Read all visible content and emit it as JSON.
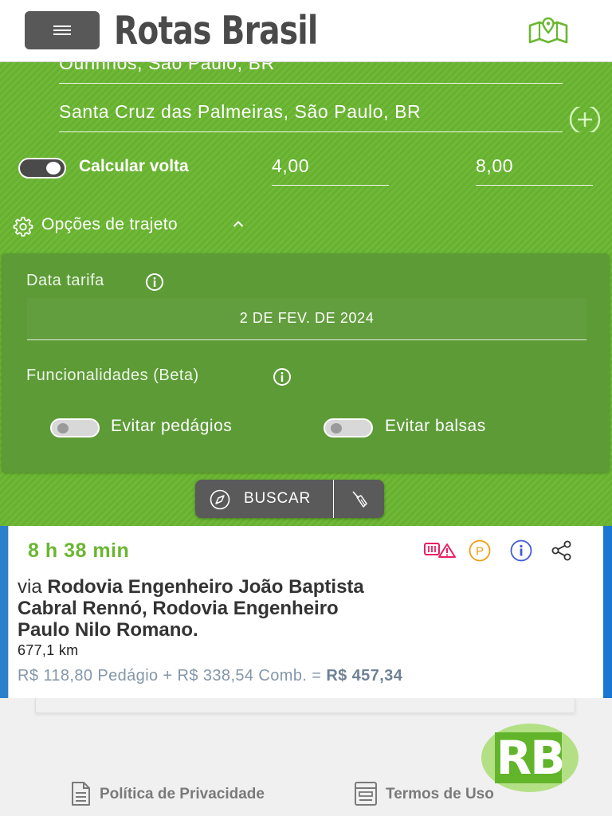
{
  "header": {
    "logo_text": "Rotas Brasil",
    "menu_icon": "hamburger-icon",
    "map_icon": "map-pin-icon"
  },
  "route": {
    "origin": "Ourinhos, São Paulo, BR",
    "destination": "Santa Cruz das Palmeiras, São Paulo, BR",
    "add_icon": "plus-circle-icon"
  },
  "options": {
    "calcular_volta_label": "Calcular volta",
    "calcular_volta_on": true,
    "fuel_consumption": "4,00",
    "fuel_price": "8,00",
    "trajeto_label": "Opções de trajeto"
  },
  "panel": {
    "data_tarifa_label": "Data tarifa",
    "date_value": "2 DE FEV. DE 2024",
    "funcionalidades_label": "Funcionalidades (Beta)",
    "evitar_pedagios": "Evitar pedágios",
    "evitar_pedagios_on": false,
    "evitar_balsas": "Evitar balsas",
    "evitar_balsas_on": false
  },
  "search": {
    "label": "BUSCAR"
  },
  "result": {
    "duration": "8 h 38 min",
    "via_prefix": "via",
    "via_road_lines": [
      "Rodovia Engenheiro João Baptista",
      "Cabral Rennó, Rodovia Engenheiro",
      "Paulo Nilo Romano."
    ],
    "distance": "677,1 km",
    "cost_text": "R$ 118,80 Pedágio + R$ 338,54 Comb. =",
    "total": "R$ 457,34"
  },
  "footer": {
    "privacy": "Política de Privacidade",
    "terms": "Termos de Uso",
    "badge_text": "RB"
  },
  "colors": {
    "brand_green": "#6ab631",
    "panel_green": "#5d9b37",
    "duration_green": "#6ab631",
    "accent_blue": "#1976d2",
    "cost_gray": "#8496a8",
    "button_gray": "#5a5a5a"
  }
}
